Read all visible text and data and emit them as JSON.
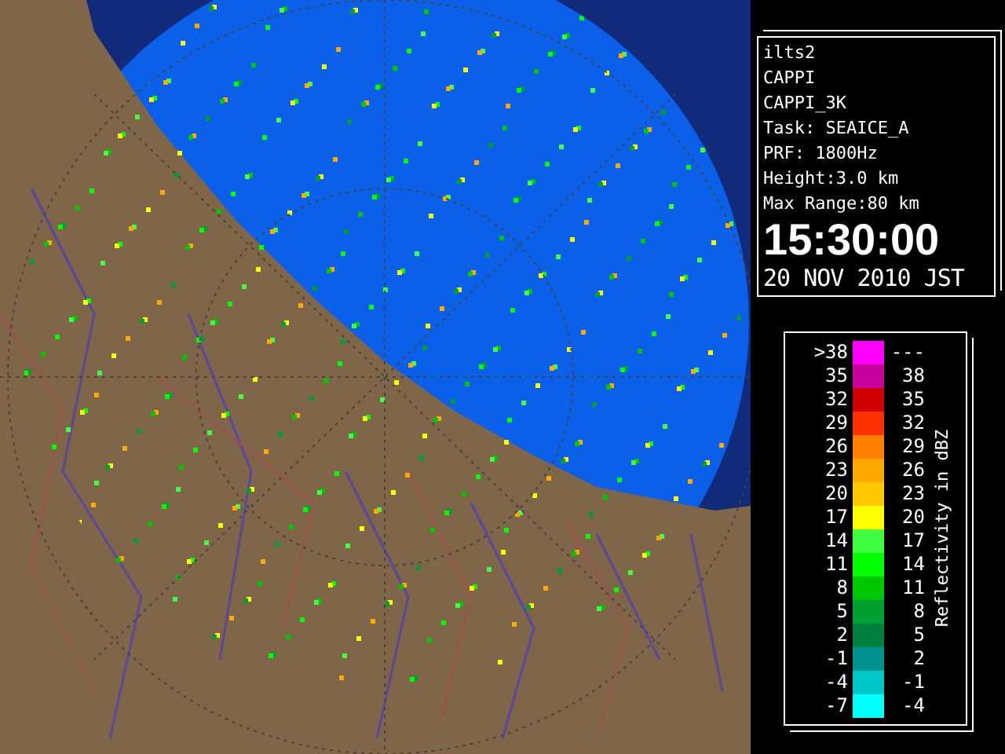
{
  "info": {
    "lines": [
      "ilts2",
      "CAPPI",
      "CAPPI_3K",
      "Task: SEAICE_A",
      "PRF: 1800Hz",
      "Height:3.0 km",
      "Max Range:80 km"
    ],
    "time": "15:30:00",
    "date": "20 NOV 2010 JST"
  },
  "legend": {
    "axis_label": "Reflectivity in dBZ",
    "rows": [
      {
        "low": ">38",
        "high": "---",
        "color": "#ff00ff"
      },
      {
        "low": "35",
        "high": "38",
        "color": "#c8009a"
      },
      {
        "low": "32",
        "high": "35",
        "color": "#d00000"
      },
      {
        "low": "29",
        "high": "32",
        "color": "#ff3000"
      },
      {
        "low": "26",
        "high": "29",
        "color": "#ff8000"
      },
      {
        "low": "23",
        "high": "26",
        "color": "#ffa800"
      },
      {
        "low": "20",
        "high": "23",
        "color": "#ffc800"
      },
      {
        "low": "17",
        "high": "20",
        "color": "#ffff00"
      },
      {
        "low": "14",
        "high": "17",
        "color": "#40ff40"
      },
      {
        "low": "11",
        "high": "14",
        "color": "#00ff00"
      },
      {
        "low": "8",
        "high": "11",
        "color": "#00c800"
      },
      {
        "low": "5",
        "high": "8",
        "color": "#00a030"
      },
      {
        "low": "2",
        "high": "5",
        "color": "#008040"
      },
      {
        "low": "-1",
        "high": "2",
        "color": "#009090"
      },
      {
        "low": "-4",
        "high": "-1",
        "color": "#00c8c8"
      },
      {
        "low": "-7",
        "high": "-4",
        "color": "#00ffff"
      }
    ]
  }
}
